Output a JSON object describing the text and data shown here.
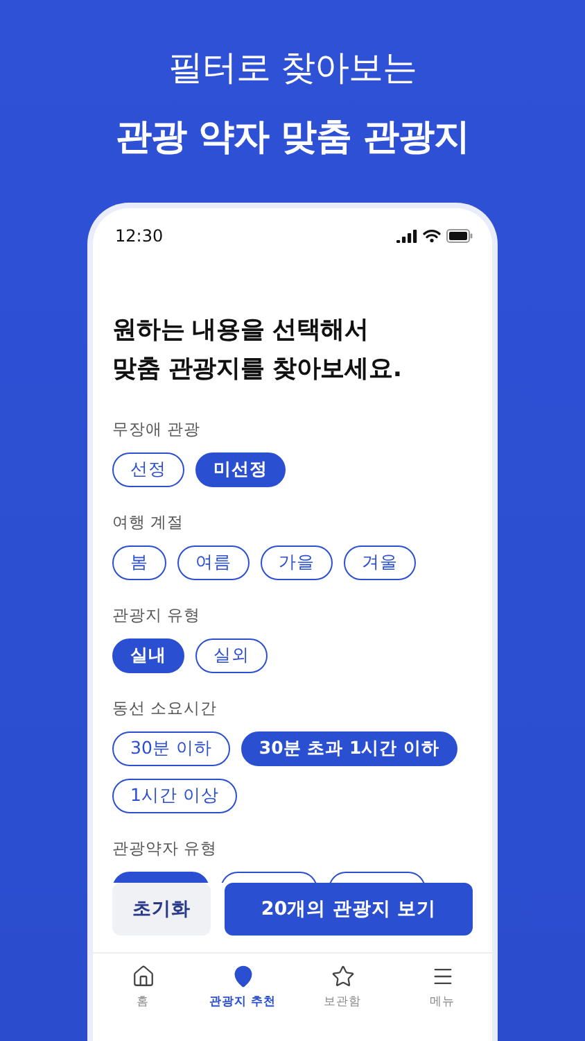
{
  "header": {
    "subtitle": "필터로 찾아보는",
    "title": "관광 약자 맞춤 관광지"
  },
  "status_bar": {
    "time": "12:30"
  },
  "heading": "원하는 내용을 선택해서\n맞춤 관광지를 찾아보세요.",
  "filters": [
    {
      "label": "무장애 관광",
      "options": [
        {
          "label": "선정",
          "selected": false
        },
        {
          "label": "미선정",
          "selected": true
        }
      ]
    },
    {
      "label": "여행 계절",
      "options": [
        {
          "label": "봄",
          "selected": false
        },
        {
          "label": "여름",
          "selected": false
        },
        {
          "label": "가을",
          "selected": false
        },
        {
          "label": "겨울",
          "selected": false
        }
      ]
    },
    {
      "label": "관광지 유형",
      "options": [
        {
          "label": "실내",
          "selected": true
        },
        {
          "label": "실외",
          "selected": false
        }
      ]
    },
    {
      "label": "동선 소요시간",
      "options": [
        {
          "label": "30분 이하",
          "selected": false
        },
        {
          "label": "30분 초과 1시간 이하",
          "selected": true
        },
        {
          "label": "1시간 이상",
          "selected": false
        }
      ]
    },
    {
      "label": "관광약자 유형",
      "options": [
        {
          "selected": true
        },
        {
          "selected": false
        },
        {
          "selected": false
        }
      ]
    }
  ],
  "actions": {
    "reset": "초기화",
    "apply": "20개의 관광지 보기"
  },
  "nav": [
    {
      "kind": "home",
      "label": "홈",
      "selected": false
    },
    {
      "kind": "pin",
      "label": "관광지 추천",
      "selected": true
    },
    {
      "kind": "star",
      "label": "보관함",
      "selected": false
    },
    {
      "kind": "menu",
      "label": "메뉴",
      "selected": false
    }
  ]
}
